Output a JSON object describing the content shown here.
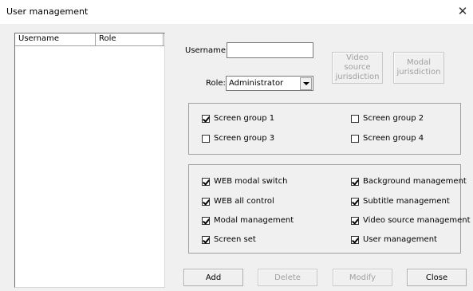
{
  "window": {
    "title": "User management",
    "close_glyph": "✕"
  },
  "user_list": {
    "columns": [
      "Username",
      "Role"
    ],
    "rows": []
  },
  "form": {
    "username_label": "Username:",
    "username_value": "",
    "role_label": "Role:",
    "role_value": "Administrator"
  },
  "buttons": {
    "video_source_jurisdiction": "Video source\njurisdiction",
    "modal_jurisdiction": "Modal\njurisdiction",
    "add": "Add",
    "delete": "Delete",
    "modify": "Modify",
    "close": "Close"
  },
  "screen_groups": [
    {
      "label": "Screen group 1",
      "checked": true
    },
    {
      "label": "Screen group 2",
      "checked": false
    },
    {
      "label": "Screen group 3",
      "checked": false
    },
    {
      "label": "Screen group 4",
      "checked": false
    }
  ],
  "permissions": [
    {
      "label": "WEB modal switch",
      "checked": true
    },
    {
      "label": "Background management",
      "checked": true
    },
    {
      "label": "WEB all control",
      "checked": true
    },
    {
      "label": "Subtitle management",
      "checked": true
    },
    {
      "label": "Modal management",
      "checked": true
    },
    {
      "label": "Video source management",
      "checked": true
    },
    {
      "label": "Screen set",
      "checked": true
    },
    {
      "label": "User management",
      "checked": true
    }
  ]
}
